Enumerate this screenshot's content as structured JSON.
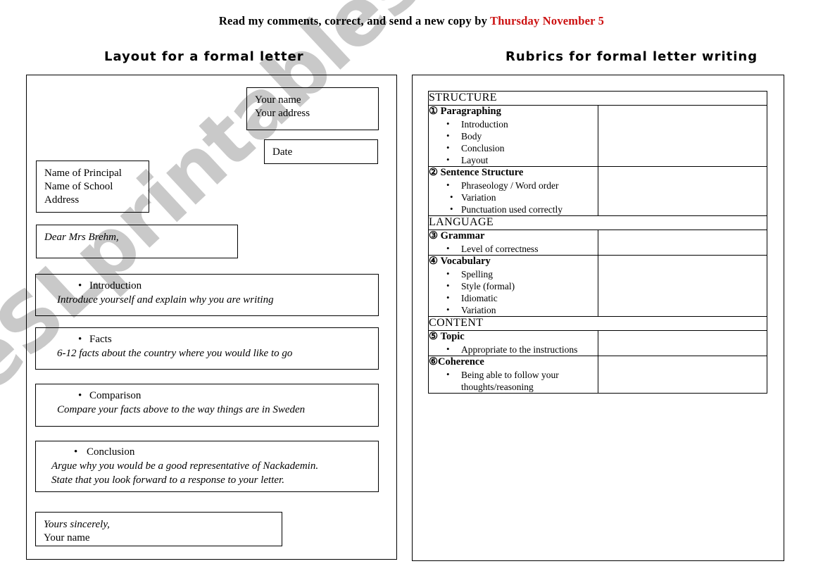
{
  "top_instruction": {
    "main": "Read my comments, correct, and send a new copy by ",
    "due": "Thursday November 5",
    "due_color": "#cc1111"
  },
  "left_panel": {
    "title": "Layout for a formal letter",
    "sender_box": {
      "line1": "Your name",
      "line2": "Your address"
    },
    "date_box": {
      "label": "Date"
    },
    "recipient_box": {
      "line1": "Name of Principal",
      "line2": "Name of School",
      "line3": "Address"
    },
    "salutation_box": {
      "text": "Dear Mrs Brehm,"
    },
    "sections": [
      {
        "heading": "Introduction",
        "description": "Introduce yourself and explain why you are writing"
      },
      {
        "heading": "Facts",
        "description": "6-12 facts about the country where you would like to go"
      },
      {
        "heading": "Comparison",
        "description": "Compare your facts above to the way things are in Sweden"
      },
      {
        "heading": "Conclusion",
        "description_line1": "Argue why you would be a good representative of Nackademin.",
        "description_line2": "State that you look forward to a response to your letter."
      }
    ],
    "signature_box": {
      "line1": "Yours sincerely,",
      "line2": "Your name"
    }
  },
  "right_panel": {
    "title": "Rubrics for formal letter writing",
    "sections": [
      {
        "name": "STRUCTURE",
        "criteria": [
          {
            "number": "①",
            "title": "Paragraphing",
            "items": [
              "Introduction",
              "Body",
              "Conclusion",
              "Layout"
            ]
          },
          {
            "number": "②",
            "title": "Sentence Structure",
            "items": [
              "Phraseology / Word order",
              "Variation",
              "Punctuation used correctly"
            ]
          }
        ]
      },
      {
        "name": "LANGUAGE",
        "criteria": [
          {
            "number": "③",
            "title": "Grammar",
            "items": [
              "Level of correctness"
            ]
          },
          {
            "number": "④",
            "title": "Vocabulary",
            "items": [
              "Spelling",
              "Style (formal)",
              "Idiomatic",
              "Variation"
            ]
          }
        ]
      },
      {
        "name": "CONTENT",
        "criteria": [
          {
            "number": "⑤",
            "title": "Topic",
            "items": [
              "Appropriate to the instructions"
            ]
          },
          {
            "number": "⑥",
            "title": "Coherence",
            "items": [
              "Being able to follow your thoughts/reasoning"
            ]
          }
        ]
      }
    ]
  },
  "watermark": {
    "text": "eSLprintables.com",
    "color": "#c9c9c9"
  }
}
